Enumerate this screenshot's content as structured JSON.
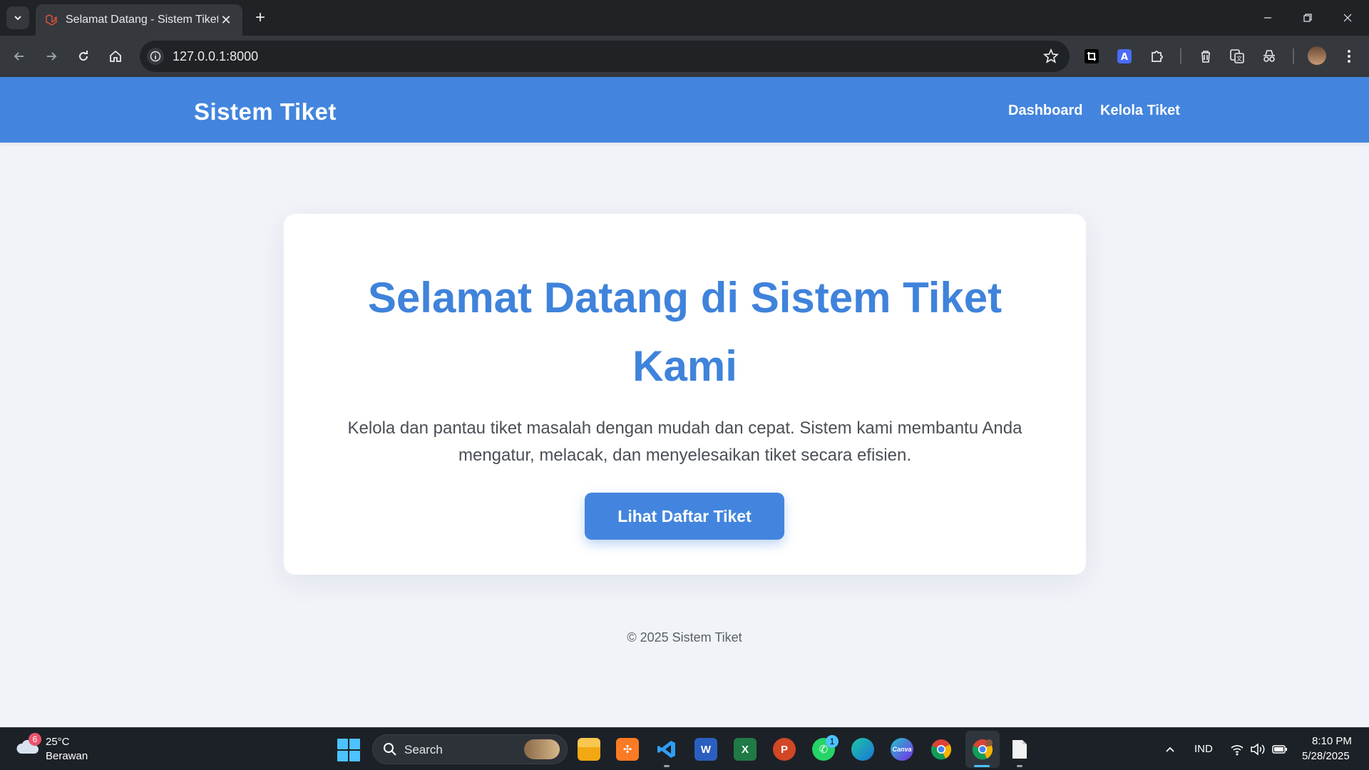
{
  "browser": {
    "tab_title": "Selamat Datang - Sistem Tiket",
    "url": "127.0.0.1:8000"
  },
  "header": {
    "brand": "Sistem Tiket",
    "nav": [
      {
        "label": "Dashboard"
      },
      {
        "label": "Kelola Tiket"
      }
    ]
  },
  "hero": {
    "title_line1": "Selamat Datang di Sistem Tiket",
    "title_line2": "Kami",
    "description_line1": "Kelola dan pantau tiket masalah dengan mudah dan cepat. Sistem kami membantu Anda",
    "description_line2": "mengatur, melacak, dan menyelesaikan tiket secara efisien.",
    "cta_label": "Lihat Daftar Tiket"
  },
  "footer": {
    "text": "© 2025 Sistem Tiket"
  },
  "taskbar": {
    "weather_badge": "6",
    "temperature": "25°C",
    "weather": "Berawan",
    "search_label": "Search",
    "whatsapp_badge": "1",
    "language": "IND",
    "time": "8:10 PM",
    "date": "5/28/2025"
  },
  "colors": {
    "primary": "#4385de",
    "title": "#3f83db",
    "page_bg": "#f0f3f8"
  }
}
